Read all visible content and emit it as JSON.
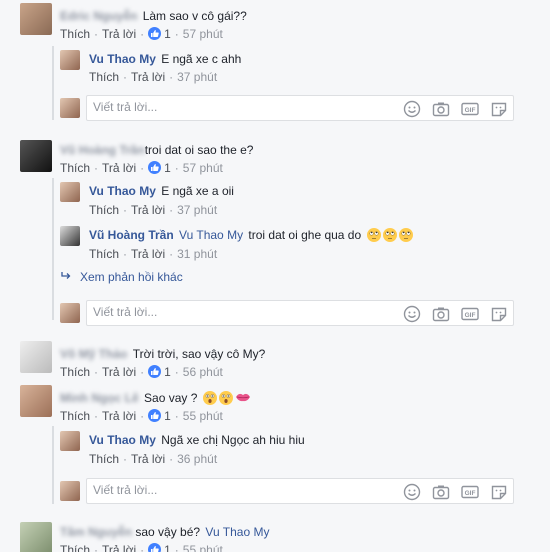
{
  "actions": {
    "like": "Thích",
    "reply": "Trả lời",
    "separator": "·"
  },
  "reply_placeholder": "Viết trả lời...",
  "see_more_replies": "Xem phản hồi khác",
  "threads": [
    {
      "author": "Edric Nguyễn",
      "text": "Làm sao v cô gái??",
      "likes": "1",
      "time": "57 phút",
      "replies": [
        {
          "author": "Vu Thao My",
          "text": "E ngã xe c ahh",
          "time": "37 phút"
        }
      ]
    },
    {
      "author": "Vũ Hoàng Trần",
      "text": "troi dat oi sao the e?",
      "likes": "1",
      "time": "57 phút",
      "replies": [
        {
          "author": "Vu Thao My",
          "text": "E ngã xe a oii",
          "time": "37 phút"
        },
        {
          "author": "Vũ Hoàng Trần",
          "mention": "Vu Thao My",
          "text": "troi dat oi ghe qua do",
          "time": "31 phút"
        }
      ]
    },
    {
      "author": "Võ Mỹ Thảo",
      "text": "Trời trời, sao vậy cô My?",
      "likes": "1",
      "time": "56 phút"
    },
    {
      "author": "Minh Ngọc Lê",
      "text": "Sao vay ?",
      "likes": "1",
      "time": "55 phút",
      "replies": [
        {
          "author": "Vu Thao My",
          "text": "Ngã xe chị Ngọc ah hiu hiu",
          "time": "36 phút"
        }
      ]
    },
    {
      "author": "Tâm Nguyễn",
      "text": "sao vậy bé?",
      "mention": "Vu Thao My",
      "likes": "1",
      "time": "55 phút"
    }
  ],
  "colors": {
    "link": "#365899",
    "like_badge": "#4080ff",
    "muted": "#90949c",
    "background": "#f6f7f9"
  },
  "icons": [
    "like-thumb-icon",
    "emoji-icon",
    "camera-icon",
    "gif-icon",
    "sticker-icon"
  ]
}
